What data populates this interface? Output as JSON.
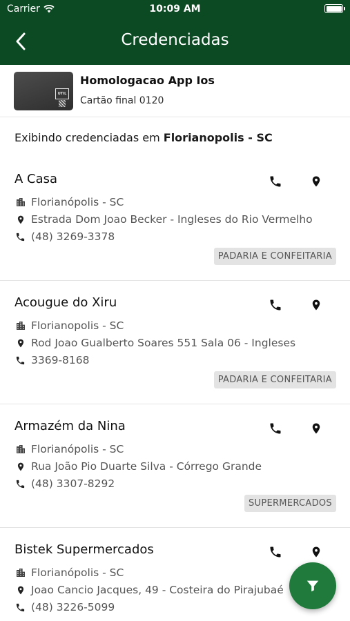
{
  "status_bar": {
    "carrier": "Carrier",
    "time": "10:09 AM"
  },
  "nav": {
    "title": "Credenciadas"
  },
  "card": {
    "image_text": "UTIL",
    "name": "Homologacao App Ios",
    "subtitle": "Cartão final 0120"
  },
  "showing": {
    "prefix": "Exibindo credenciadas em",
    "location": "Florianopolis - SC"
  },
  "merchants": [
    {
      "name": "A Casa",
      "city": "Florianópolis - SC",
      "address": "Estrada Dom Joao Becker - Ingleses do Rio Vermelho",
      "phone": "(48) 3269-3378",
      "category": "PADARIA E CONFEITARIA"
    },
    {
      "name": "Acougue do Xiru",
      "city": "Florianopolis - SC",
      "address": "Rod Joao Gualberto Soares 551 Sala 06 - Ingleses",
      "phone": "3369-8168",
      "category": "PADARIA E CONFEITARIA"
    },
    {
      "name": "Armazém da Nina",
      "city": "Florianópolis - SC",
      "address": "Rua João Pio Duarte Silva - Córrego Grande",
      "phone": "(48) 3307-8292",
      "category": "SUPERMERCADOS"
    },
    {
      "name": "Bistek Supermercados",
      "city": "Florianópolis - SC",
      "address": "Joao Cancio Jacques, 49 - Costeira do Pirajubaé",
      "phone": "(48) 3226-5099",
      "category": ""
    }
  ],
  "icons": {
    "back": "chevron-left-icon",
    "phone": "phone-icon",
    "pin": "map-pin-icon",
    "city": "city-buildings-icon",
    "filter": "filter-icon",
    "wifi": "wifi-icon",
    "battery": "battery-icon"
  },
  "colors": {
    "header": "#0c4a23",
    "fab": "#1f7a3c",
    "tag_bg": "#e3e3e3",
    "text_secondary": "#555555"
  }
}
